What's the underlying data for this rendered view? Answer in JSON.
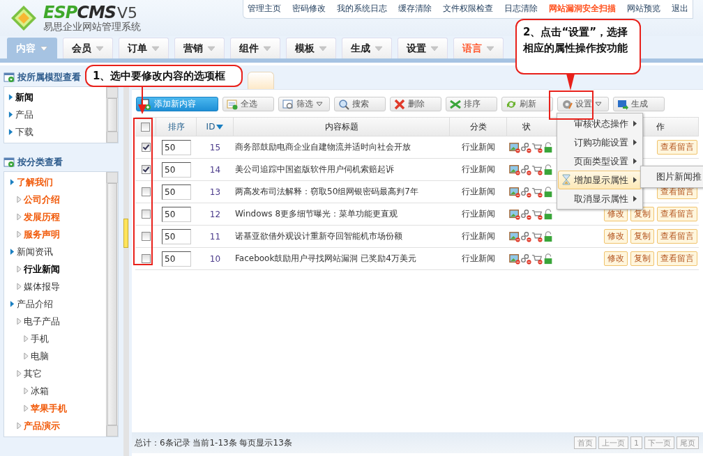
{
  "logo": {
    "brand": "ESPCMS",
    "version": "V5",
    "subtitle": "易思企业网站管理系统"
  },
  "top_links": [
    {
      "label": "管理主页",
      "alert": false
    },
    {
      "label": "密码修改",
      "alert": false
    },
    {
      "label": "我的系统日志",
      "alert": false
    },
    {
      "label": "缓存清除",
      "alert": false
    },
    {
      "label": "文件权限检查",
      "alert": false
    },
    {
      "label": "日志清除",
      "alert": false
    },
    {
      "label": "网站漏洞安全扫描",
      "alert": true
    },
    {
      "label": "网站预览",
      "alert": false
    },
    {
      "label": "退出",
      "alert": false
    }
  ],
  "nav_tabs": [
    {
      "label": "内容",
      "selected": true,
      "alert": false
    },
    {
      "label": "会员",
      "selected": false,
      "alert": false
    },
    {
      "label": "订单",
      "selected": false,
      "alert": false
    },
    {
      "label": "营销",
      "selected": false,
      "alert": false
    },
    {
      "label": "组件",
      "selected": false,
      "alert": false
    },
    {
      "label": "模板",
      "selected": false,
      "alert": false
    },
    {
      "label": "生成",
      "selected": false,
      "alert": false
    },
    {
      "label": "设置",
      "selected": false,
      "alert": false
    },
    {
      "label": "语言",
      "selected": false,
      "alert": true
    }
  ],
  "sidebar": {
    "model_panel": {
      "title": "按所属模型查看",
      "items": [
        {
          "label": "新闻",
          "selected": true
        },
        {
          "label": "产品",
          "selected": false
        },
        {
          "label": "下载",
          "selected": false
        }
      ]
    },
    "category_panel": {
      "title": "按分类查看",
      "tree": [
        {
          "label": "了解我们",
          "selected": false,
          "highlighted": true,
          "children": [
            {
              "label": "公司介绍",
              "selected": false,
              "highlighted": true
            },
            {
              "label": "发展历程",
              "selected": false,
              "highlighted": true
            },
            {
              "label": "服务声明",
              "selected": false,
              "highlighted": true
            }
          ]
        },
        {
          "label": "新闻资讯",
          "selected": false,
          "highlighted": false,
          "children": [
            {
              "label": "行业新闻",
              "selected": true,
              "highlighted": false
            },
            {
              "label": "媒体报导",
              "selected": false,
              "highlighted": false
            }
          ]
        },
        {
          "label": "产品介绍",
          "selected": false,
          "highlighted": false,
          "children": [
            {
              "label": "电子产品",
              "selected": false,
              "highlighted": false,
              "children": [
                {
                  "label": "手机",
                  "selected": false,
                  "highlighted": false
                },
                {
                  "label": "电脑",
                  "selected": false,
                  "highlighted": false
                }
              ]
            },
            {
              "label": "其它",
              "selected": false,
              "highlighted": false,
              "children": [
                {
                  "label": "冰箱",
                  "selected": false,
                  "highlighted": false
                },
                {
                  "label": "苹果手机",
                  "selected": false,
                  "highlighted": true
                }
              ]
            },
            {
              "label": "产品演示",
              "selected": false,
              "highlighted": true
            }
          ]
        }
      ]
    }
  },
  "toolbar": [
    {
      "label": "添加新内容",
      "kind": "add",
      "dropdown": false
    },
    {
      "label": "全选",
      "kind": "select_all",
      "dropdown": false
    },
    {
      "label": "筛选",
      "kind": "filter",
      "dropdown": true
    },
    {
      "label": "搜索",
      "kind": "search",
      "dropdown": false
    },
    {
      "label": "删除",
      "kind": "delete",
      "dropdown": false
    },
    {
      "label": "排序",
      "kind": "sort",
      "dropdown": false
    },
    {
      "label": "刷新",
      "kind": "refresh",
      "dropdown": false
    },
    {
      "label": "设置",
      "kind": "settings",
      "dropdown": true
    },
    {
      "label": "生成",
      "kind": "generate",
      "dropdown": false
    }
  ],
  "table": {
    "select_all_checked": false,
    "columns": [
      {
        "label": "排序",
        "sorted": false
      },
      {
        "label": "ID",
        "sorted": true
      },
      {
        "label": "内容标题",
        "sorted": false
      },
      {
        "label": "分类",
        "sorted": false
      },
      {
        "label": "状",
        "sorted": false
      },
      {
        "label": "作",
        "sorted": false
      }
    ],
    "rows": [
      {
        "checked": true,
        "order": "50",
        "id": "15",
        "title": "商务部鼓励电商企业自建物流并适时向社会开放",
        "category": "行业新闻",
        "actions": [
          "查看留言"
        ]
      },
      {
        "checked": true,
        "order": "50",
        "id": "14",
        "title": "美公司追踪中国盗版软件用户伺机索赔起诉",
        "category": "行业新闻"
      },
      {
        "checked": false,
        "order": "50",
        "id": "13",
        "title": "两高发布司法解释：窃取50组网银密码最高判7年",
        "category": "行业新闻",
        "actions": [
          "查看留言"
        ]
      },
      {
        "checked": false,
        "order": "50",
        "id": "12",
        "title": "Windows 8更多细节曝光：菜单功能更直观",
        "category": "行业新闻",
        "actions": [
          "修改",
          "复制",
          "查看留言"
        ]
      },
      {
        "checked": false,
        "order": "50",
        "id": "11",
        "title": "诺基亚欲借外观设计重新夺回智能机市场份额",
        "category": "行业新闻",
        "actions": [
          "修改",
          "复制",
          "查看留言"
        ]
      },
      {
        "checked": false,
        "order": "50",
        "id": "10",
        "title": "Facebook鼓励用户寻找网站漏洞 已奖励4万美元",
        "category": "行业新闻",
        "actions": [
          "修改",
          "复制",
          "查看留言"
        ]
      }
    ]
  },
  "settings_menu": {
    "items": [
      {
        "label": "审核状态操作",
        "selected": false
      },
      {
        "label": "订购功能设置",
        "selected": false
      },
      {
        "label": "页面类型设置",
        "selected": false
      },
      {
        "label": "增加显示属性",
        "selected": true
      },
      {
        "label": "取消显示属性",
        "selected": false
      }
    ],
    "submenu": [
      "图片新闻推"
    ]
  },
  "footer": {
    "summary": "总计：6条记录 当前1-13条 每页显示13条",
    "pages": [
      "首页",
      "上一页",
      "1",
      "下一页",
      "尾页"
    ]
  },
  "annotations": [
    {
      "text": "1、选中要修改内容的选项框"
    },
    {
      "text": "2、点击“设置”，选择相应的属性操作按功能"
    }
  ]
}
